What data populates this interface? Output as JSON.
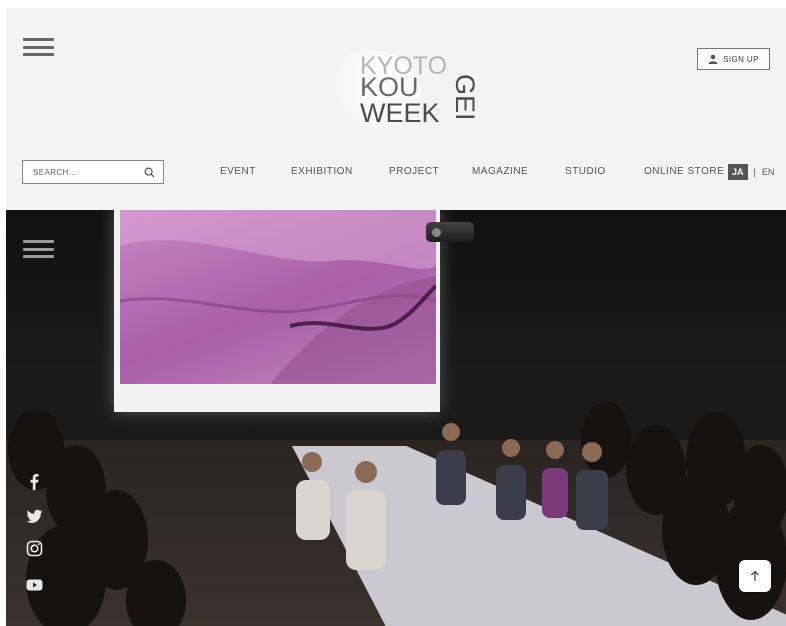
{
  "header": {
    "logo": {
      "line1": "KYOTO",
      "line2": "KOU",
      "line3": "WEEK",
      "vertical": "GEI"
    },
    "signup_label": "SIGN UP",
    "search": {
      "placeholder": "SEARCH..."
    },
    "nav": [
      "EVENT",
      "EXHIBITION",
      "PROJECT",
      "MAGAZINE",
      "STUDIO",
      "ONLINE STORE"
    ],
    "lang": {
      "active": "JA",
      "separator": "|",
      "other": "EN"
    }
  },
  "icons": {
    "menu": "hamburger-icon",
    "user": "user-icon",
    "search": "search-icon",
    "social": [
      "facebook-icon",
      "twitter-icon",
      "instagram-icon",
      "youtube-icon"
    ],
    "to_top": "arrow-up-icon"
  },
  "colors": {
    "header_bg": "#f3f3f3",
    "screen_image": "#b46eb1",
    "lang_active_bg": "#555555"
  }
}
